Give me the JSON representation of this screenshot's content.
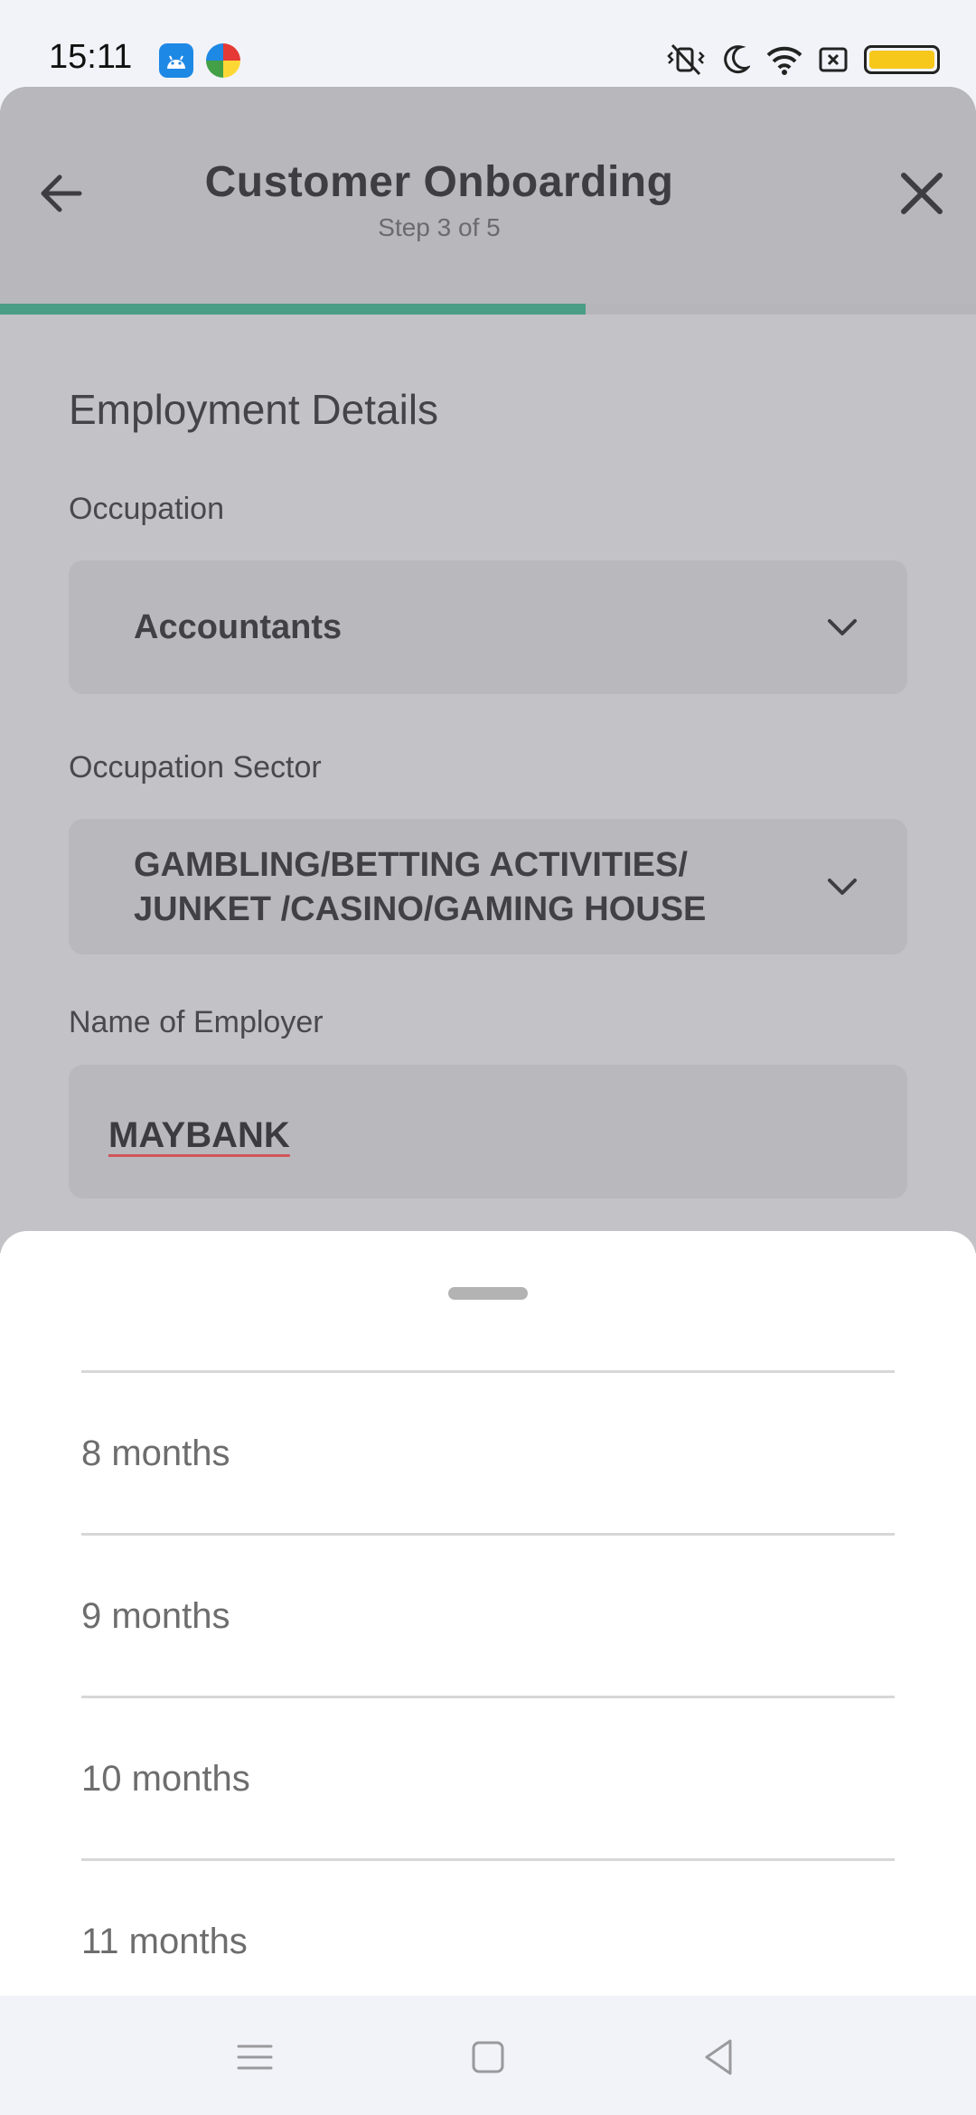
{
  "status_bar": {
    "time": "15:11",
    "icons": [
      "android-icon",
      "browser-icon",
      "vibrate-mute-icon",
      "moon-icon",
      "wifi-icon",
      "sim-icon",
      "battery-icon"
    ]
  },
  "header": {
    "title": "Customer Onboarding",
    "step": "Step 3 of 5",
    "progress": 0.6,
    "accent_color": "#4a9e85"
  },
  "form": {
    "section_title": "Employment Details",
    "occupation": {
      "label": "Occupation",
      "value": "Accountants"
    },
    "occupation_sector": {
      "label": "Occupation Sector",
      "value_line1": "GAMBLING/BETTING ACTIVITIES/",
      "value_line2": "JUNKET /CASINO/GAMING HOUSE"
    },
    "employer": {
      "label": "Name of Employer",
      "value": "MAYBANK"
    }
  },
  "sheet": {
    "options": [
      "8 months",
      "9 months",
      "10 months",
      "11 months"
    ]
  },
  "nav": {
    "icons": [
      "menu-icon",
      "home-icon",
      "back-icon"
    ]
  }
}
